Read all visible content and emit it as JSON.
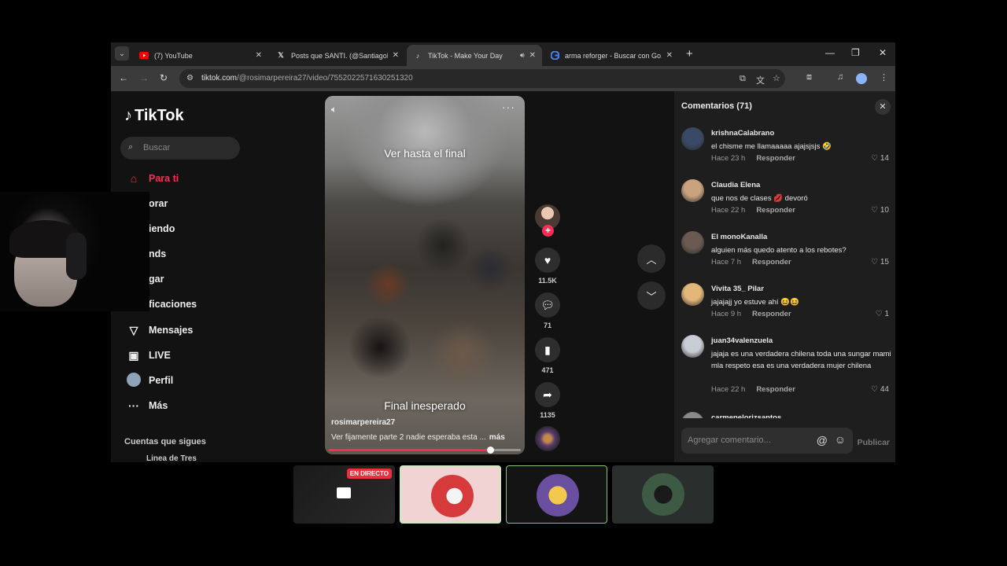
{
  "browser": {
    "tabs": [
      {
        "title": "(7) YouTube",
        "icon": "youtube-icon",
        "active": false
      },
      {
        "title": "Posts que SANTI. (@SantiagoLe...",
        "icon": "x-icon",
        "active": false
      },
      {
        "title": "TikTok - Make Your Day",
        "icon": "tiktok-icon",
        "active": true
      },
      {
        "title": "arma reforger - Buscar con Go...",
        "icon": "google-icon",
        "active": false
      }
    ],
    "url_host": "tiktok.com",
    "url_path": "/@rosimarpereira27/video/7552022571630251320"
  },
  "sidebar": {
    "logo_text": "TikTok",
    "search_placeholder": "Buscar",
    "items": [
      {
        "label": "Para ti",
        "icon": "home-icon",
        "active": true
      },
      {
        "label": "orar",
        "icon": "compass-icon"
      },
      {
        "label": "iendo",
        "icon": "users-icon"
      },
      {
        "label": "nds",
        "icon": "friends-icon"
      },
      {
        "label": "gar",
        "icon": "upload-icon"
      },
      {
        "label": "ficaciones",
        "icon": "bell-icon"
      },
      {
        "label": "Mensajes",
        "icon": "send-icon"
      },
      {
        "label": "LIVE",
        "icon": "live-icon"
      },
      {
        "label": "Perfil",
        "icon": "profile-avatar"
      },
      {
        "label": "Más",
        "icon": "more-icon"
      }
    ],
    "following_title": "Cuentas que sigues",
    "following_user": "Linea de Tres"
  },
  "video": {
    "overlay_top": "Ver hasta el final",
    "overlay_bottom": "Final inesperado",
    "author": "rosimarpereira27",
    "description": "Ver fijamente parte 2 nadie esperaba esta ...",
    "more_label": "más",
    "progress_fraction": 0.84
  },
  "actions": {
    "likes": "11.5K",
    "comments": "71",
    "saves": "471",
    "shares": "1135"
  },
  "comments_panel": {
    "title": "Comentarios (71)",
    "reply_label": "Responder",
    "input_placeholder": "Agregar comentario...",
    "post_label": "Publicar",
    "items": [
      {
        "user": "krishnaCalabrano",
        "text": "el chisme me llamaaaaa ajajsjsjs 🤣",
        "time": "Hace 23 h",
        "likes": "14",
        "color": "#3a4a66"
      },
      {
        "user": "Claudia Elena",
        "text": "que nos de clases 💋 devoró",
        "time": "Hace 22 h",
        "likes": "10",
        "color": "#c9a27e"
      },
      {
        "user": "El monoKanalla",
        "text": "alguien más quedo atento a los rebotes?",
        "time": "Hace 7 h",
        "likes": "15",
        "color": "#6b5a52"
      },
      {
        "user": "Vivita 35_ Pilar",
        "text": "jajajajj yo estuve ahí 😆😆",
        "time": "Hace 9 h",
        "likes": "1",
        "color": "#e3b77a"
      },
      {
        "user": "juan34valenzuela",
        "text": "jajaja es una verdadera chilena toda una sungar mami mla respeto esa es una verdadera mujer chilena",
        "time": "Hace 22 h",
        "likes": "44",
        "color": "#c8ccd4"
      },
      {
        "user": "carmenelorizsantos",
        "text": "",
        "time": "",
        "likes": "",
        "color": "#8a8a8a"
      }
    ]
  },
  "stream_tiles": {
    "live_badge": "EN DIRECTO"
  }
}
